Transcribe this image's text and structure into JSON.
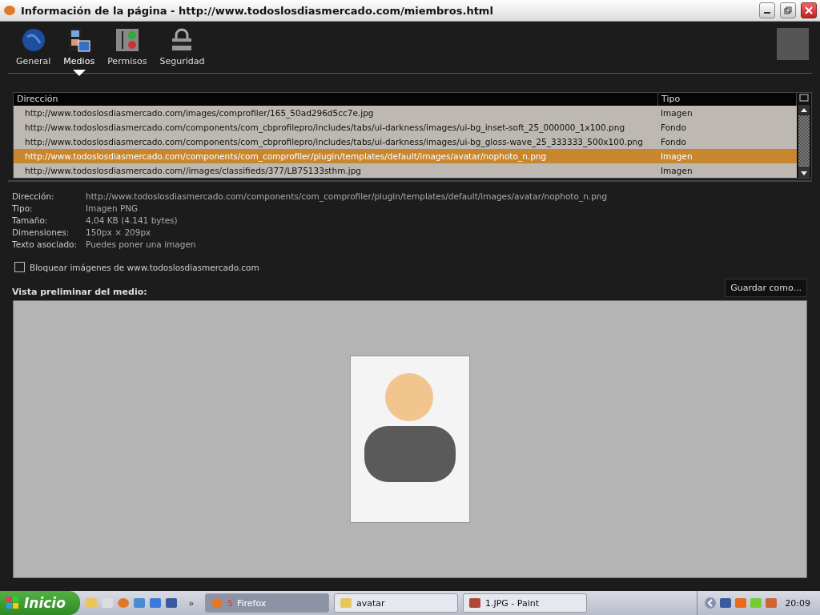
{
  "window": {
    "title": "Información de la página - http://www.todoslosdiasmercado.com/miembros.html"
  },
  "tabs": [
    {
      "label": "General",
      "selected": false,
      "kind": "globe"
    },
    {
      "label": "Medios",
      "selected": true,
      "kind": "media"
    },
    {
      "label": "Permisos",
      "selected": false,
      "kind": "permissions"
    },
    {
      "label": "Seguridad",
      "selected": false,
      "kind": "lock"
    }
  ],
  "table": {
    "columns": [
      "Dirección",
      "Tipo"
    ],
    "rows": [
      {
        "address": "http://www.todoslosdiasmercado.com/images/comprofiler/165_50ad296d5cc7e.jpg",
        "type": "Imagen",
        "selected": false
      },
      {
        "address": "http://www.todoslosdiasmercado.com/components/com_cbprofilepro/includes/tabs/ui-darkness/images/ui-bg_inset-soft_25_000000_1x100.png",
        "type": "Fondo",
        "selected": false
      },
      {
        "address": "http://www.todoslosdiasmercado.com/components/com_cbprofilepro/includes/tabs/ui-darkness/images/ui-bg_gloss-wave_25_333333_500x100.png",
        "type": "Fondo",
        "selected": false
      },
      {
        "address": "http://www.todoslosdiasmercado.com/components/com_comprofiler/plugin/templates/default/images/avatar/nophoto_n.png",
        "type": "Imagen",
        "selected": true
      },
      {
        "address": "http://www.todoslosdiasmercado.com//images/classifieds/377/LB75133sthm.jpg",
        "type": "Imagen",
        "selected": false
      }
    ]
  },
  "details": [
    {
      "label": "Dirección:",
      "value": "http://www.todoslosdiasmercado.com/components/com_comprofiler/plugin/templates/default/images/avatar/nophoto_n.png"
    },
    {
      "label": "Tipo:",
      "value": "Imagen PNG"
    },
    {
      "label": "Tamaño:",
      "value": "4,04 KB (4.141 bytes)"
    },
    {
      "label": "Dimensiones:",
      "value": "150px × 209px"
    },
    {
      "label": "Texto asociado:",
      "value": "Puedes poner una imagen"
    }
  ],
  "block_checkbox": {
    "label": "Bloquear imágenes de www.todoslosdiasmercado.com",
    "checked": false
  },
  "preview": {
    "title": "Vista preliminar del medio:",
    "save_button": "Guardar como..."
  },
  "taskbar": {
    "start": "Inicio",
    "more": "»",
    "tasks": [
      {
        "label": "Firefox",
        "count": "5",
        "selected": true,
        "kind": "firefox"
      },
      {
        "label": "avatar",
        "selected": false,
        "kind": "folder"
      },
      {
        "label": "1.JPG - Paint",
        "selected": false,
        "kind": "paint"
      }
    ],
    "clock": "20:09"
  }
}
